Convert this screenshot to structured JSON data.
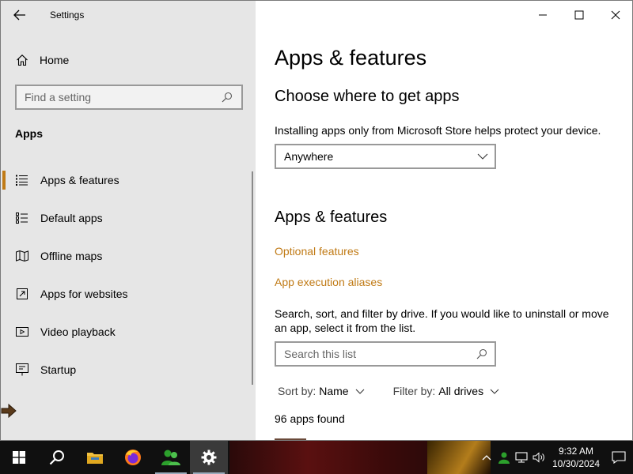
{
  "window": {
    "title": "Settings"
  },
  "sidebar": {
    "home_label": "Home",
    "search_placeholder": "Find a setting",
    "section_label": "Apps",
    "items": [
      {
        "label": "Apps & features",
        "icon": "list-icon",
        "active": true
      },
      {
        "label": "Default apps",
        "icon": "default-apps-icon",
        "active": false
      },
      {
        "label": "Offline maps",
        "icon": "map-icon",
        "active": false
      },
      {
        "label": "Apps for websites",
        "icon": "open-in-icon",
        "active": false
      },
      {
        "label": "Video playback",
        "icon": "video-icon",
        "active": false
      },
      {
        "label": "Startup",
        "icon": "startup-icon",
        "active": false
      }
    ]
  },
  "main": {
    "page_title": "Apps & features",
    "choose_heading": "Choose where to get apps",
    "choose_desc": "Installing apps only from Microsoft Store helps protect your device.",
    "source_dropdown_value": "Anywhere",
    "features_heading": "Apps & features",
    "links": {
      "optional_features": "Optional features",
      "execution_aliases": "App execution aliases"
    },
    "search_desc": "Search, sort, and filter by drive. If you would like to uninstall or move an app, select it from the list.",
    "list_search_placeholder": "Search this list",
    "sort_key": "Sort by:",
    "sort_value": "Name",
    "filter_key": "Filter by:",
    "filter_value": "All drives",
    "apps_count": "96 apps found"
  },
  "taskbar": {
    "time": "9:32 AM",
    "date": "10/30/2024",
    "pinned": [
      "windows-start-icon",
      "search-icon",
      "file-explorer-icon",
      "firefox-icon",
      "people-app-icon",
      "settings-gear-icon"
    ]
  },
  "colors": {
    "accent": "#c07a15",
    "sidebar_bg": "#e6e6e6",
    "taskbar_bg": "#101010"
  }
}
